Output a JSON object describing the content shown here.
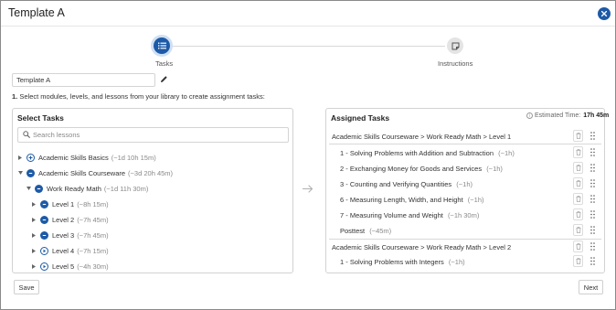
{
  "dialog": {
    "title": "Template A",
    "close_icon": "close-icon"
  },
  "stepper": {
    "steps": [
      {
        "label": "Tasks",
        "icon": "list-icon",
        "active": true
      },
      {
        "label": "Instructions",
        "icon": "note-icon",
        "active": false
      }
    ]
  },
  "template_name": {
    "value": "Template A",
    "edit_icon": "pencil-icon"
  },
  "instruction": {
    "number": "1.",
    "text": "Select modules, levels, and lessons from your library to create assignment tasks:"
  },
  "select_tasks": {
    "title": "Select Tasks",
    "search_placeholder": "Search lessons",
    "tree": [
      {
        "label": "Academic Skills Basics",
        "duration": "(~1d 10h 15m)",
        "icon": "plus-circle-icon",
        "expanded": false
      },
      {
        "label": "Academic Skills Courseware",
        "duration": "(~3d 20h 45m)",
        "icon": "minus-circle-icon",
        "expanded": true
      },
      {
        "label": "Work Ready Math",
        "duration": "(~1d 11h 30m)",
        "icon": "minus-circle-icon",
        "expanded": true
      },
      {
        "label": "Level 1",
        "duration": "(~8h 15m)",
        "icon": "minus-circle-icon",
        "expanded": false
      },
      {
        "label": "Level 2",
        "duration": "(~7h 45m)",
        "icon": "minus-circle-icon",
        "expanded": false
      },
      {
        "label": "Level 3",
        "duration": "(~7h 45m)",
        "icon": "minus-circle-icon",
        "expanded": false
      },
      {
        "label": "Level 4",
        "duration": "(~7h 15m)",
        "icon": "play-circle-icon",
        "expanded": false
      },
      {
        "label": "Level 5",
        "duration": "(~4h 30m)",
        "icon": "play-circle-icon",
        "expanded": false
      }
    ]
  },
  "assigned_tasks": {
    "title": "Assigned Tasks",
    "estimated_label": "Estimated Time:",
    "estimated_value": "17h 45m",
    "rows": [
      {
        "type": "group",
        "text": "Academic Skills Courseware > Work Ready Math > Level 1"
      },
      {
        "type": "task",
        "text": "1 - Solving Problems with Addition and Subtraction",
        "duration": "(~1h)"
      },
      {
        "type": "task",
        "text": "2 - Exchanging Money for Goods and Services",
        "duration": "(~1h)"
      },
      {
        "type": "task",
        "text": "3 - Counting and Verifying Quantities",
        "duration": "(~1h)"
      },
      {
        "type": "task",
        "text": "6 - Measuring Length, Width, and Height",
        "duration": "(~1h)"
      },
      {
        "type": "task",
        "text": "7 - Measuring Volume and Weight",
        "duration": "(~1h 30m)"
      },
      {
        "type": "task",
        "text": "Posttest",
        "duration": "(~45m)"
      },
      {
        "type": "group",
        "text": "Academic Skills Courseware > Work Ready Math > Level 2"
      },
      {
        "type": "task",
        "text": "1 - Solving Problems with Integers",
        "duration": "(~1h)"
      }
    ]
  },
  "footer": {
    "save_label": "Save",
    "next_label": "Next"
  },
  "colors": {
    "primary": "#1d5aa7",
    "primary_light": "#cfe0f4"
  }
}
